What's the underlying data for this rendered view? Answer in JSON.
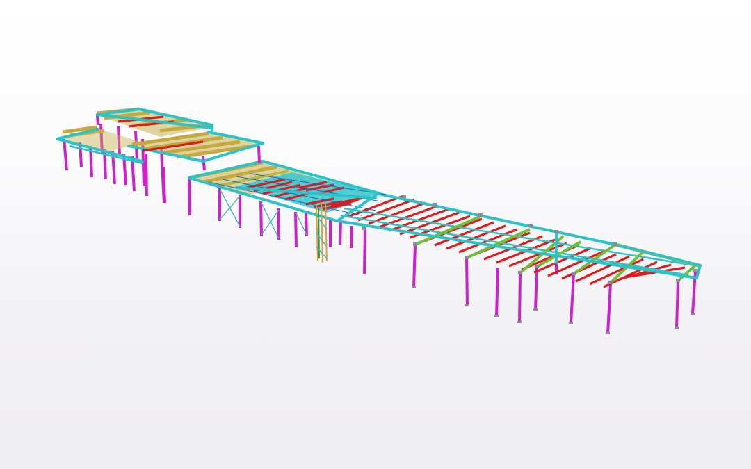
{
  "viewer": {
    "background_top": "#ffffff",
    "background_bottom": "#eeedf2"
  },
  "model": {
    "member_colors": {
      "column": "#cc22cc",
      "perimeter_beam": "#2cc3c8",
      "joist": "#e01b1b",
      "girder": "#b8b840",
      "green_beam": "#6fbf3a",
      "brace": "#3fb8c0",
      "connection_plate": "#8c8c96",
      "stair": "#d9a23a"
    },
    "icons": [
      "3d-structural-model"
    ]
  }
}
